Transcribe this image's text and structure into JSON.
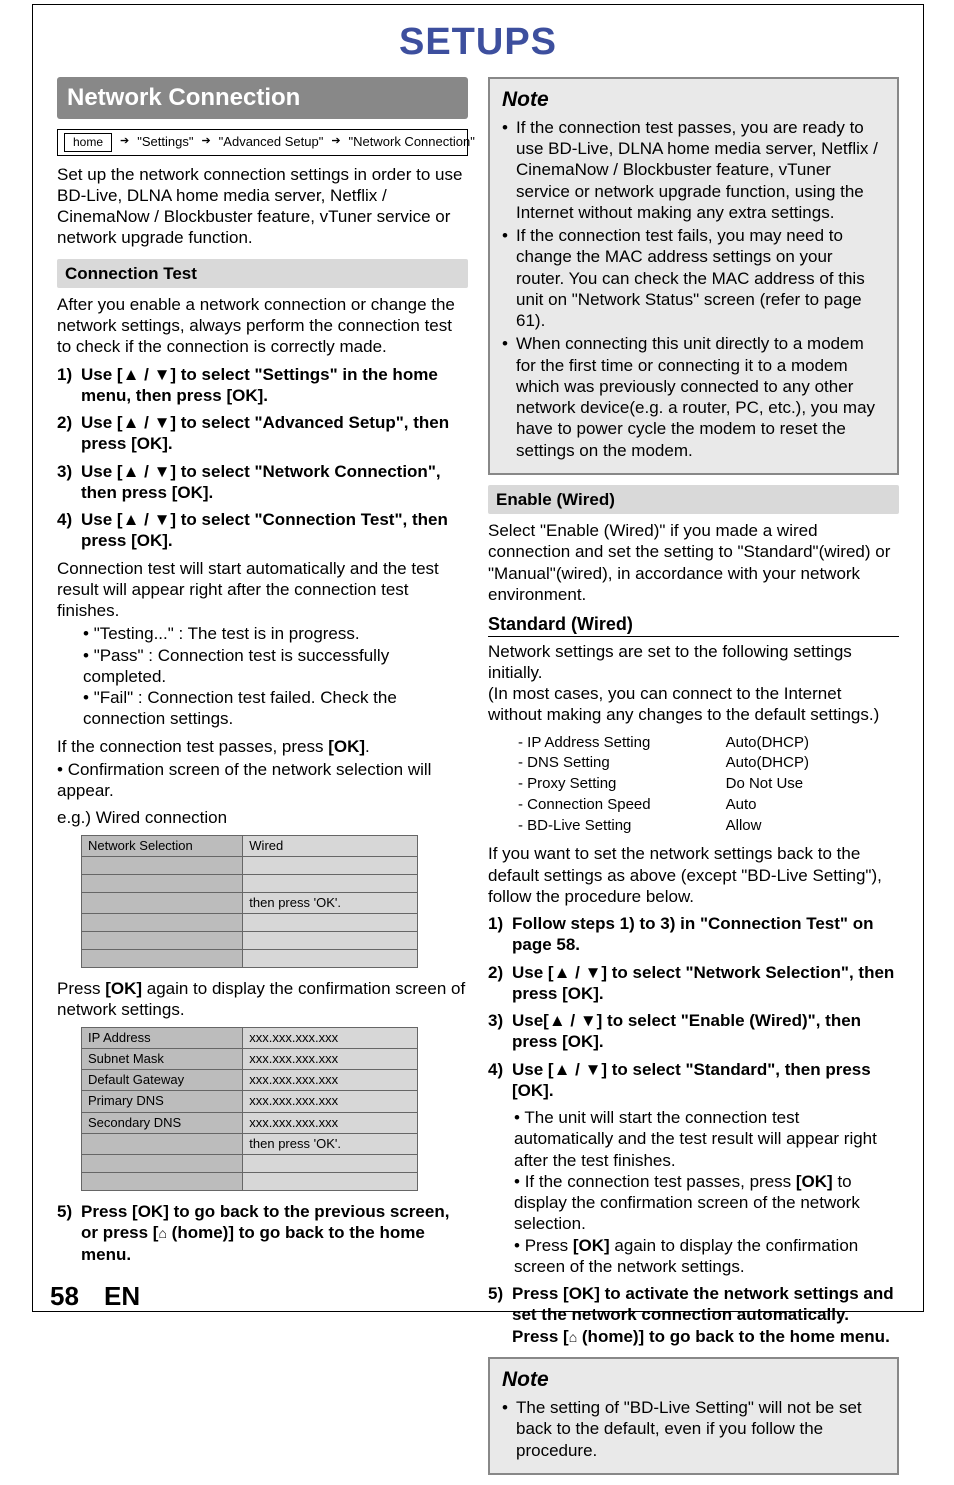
{
  "page_title": "SETUPS",
  "page_number": "58",
  "page_lang": "EN",
  "section_bar": "Network Connection",
  "breadcrumb": {
    "home": "home",
    "lvl1": "\"Settings\"",
    "lvl2": "\"Advanced Setup\"",
    "lvl3": "\"Network Connection\""
  },
  "intro": "Set up the network connection settings in order to use BD-Live, DLNA home media server, Netflix / CinemaNow / Blockbuster feature, vTuner service or network upgrade function.",
  "conn_test": {
    "heading": "Connection Test",
    "intro": "After you enable a network connection or change the network settings, always perform the connection test to check if the connection is correctly made.",
    "steps": [
      "Use [▲ / ▼] to select \"Settings\" in the home menu, then press [OK].",
      "Use [▲ / ▼] to select \"Advanced Setup\", then press [OK].",
      "Use [▲ / ▼] to select \"Network Connection\", then press [OK].",
      "Use [▲ / ▼] to select \"Connection Test\", then press [OK]."
    ],
    "after4": "Connection test will start automatically and the test result will appear right after the connection test finishes.",
    "results": [
      "\"Testing...\" : The test is in progress.",
      "\"Pass\" : Connection test is successfully completed.",
      "\"Fail\" : Connection test failed. Check the connection settings."
    ],
    "pass1_a": "If the connection test passes, press ",
    "pass1_b": "[OK]",
    "pass1_c": ".",
    "pass2": "Confirmation screen of the network selection will appear.",
    "eg": "e.g.) Wired connection",
    "table1": [
      [
        "Network Selection",
        "Wired"
      ],
      [
        "",
        ""
      ],
      [
        "",
        ""
      ],
      [
        "",
        "then press 'OK'."
      ],
      [
        "",
        ""
      ],
      [
        "",
        ""
      ],
      [
        "",
        ""
      ]
    ],
    "after_t1_a": "Press ",
    "after_t1_b": "[OK]",
    "after_t1_c": " again to display the confirmation screen of network settings.",
    "table2": [
      [
        "IP Address",
        "xxx.xxx.xxx.xxx"
      ],
      [
        "Subnet Mask",
        "xxx.xxx.xxx.xxx"
      ],
      [
        "Default Gateway",
        "xxx.xxx.xxx.xxx"
      ],
      [
        "Primary DNS",
        "xxx.xxx.xxx.xxx"
      ],
      [
        "Secondary DNS",
        "xxx.xxx.xxx.xxx"
      ],
      [
        "",
        "then press 'OK'."
      ],
      [
        "",
        ""
      ],
      [
        "",
        ""
      ]
    ],
    "step5_a": "Press [OK] to go back to the previous screen, or press [",
    "step5_b": " (home)] to go back to the home menu."
  },
  "note1": {
    "title": "Note",
    "items": [
      "If the connection test passes, you are ready to use BD-Live, DLNA home media server, Netflix / CinemaNow / Blockbuster feature, vTuner service or network upgrade function, using the Internet without making any extra settings.",
      "If the connection test fails, you may need to change the MAC address settings on your router. You can check the MAC address of this unit on \"Network Status\" screen (refer to page 61).",
      "When connecting this unit directly to a modem for the first time or connecting it to a modem which was previously connected to any other network device(e.g. a router, PC, etc.), you may have to power cycle the modem to reset the settings on the modem."
    ]
  },
  "enable": {
    "heading": "Enable (Wired)",
    "intro": "Select \"Enable (Wired)\" if you made a wired connection and set the setting to \"Standard\"(wired) or \"Manual\"(wired), in accordance with your network environment.",
    "sub": "Standard (Wired)",
    "sub_intro1": "Network settings are set to the following settings initially.",
    "sub_intro2": "(In most cases, you can connect to the Internet without making any changes to the default settings.)",
    "settings": [
      [
        "IP Address Setting",
        "Auto(DHCP)"
      ],
      [
        "DNS Setting",
        "Auto(DHCP)"
      ],
      [
        "Proxy Setting",
        "Do Not Use"
      ],
      [
        "Connection Speed",
        "Auto"
      ],
      [
        "BD-Live Setting",
        "Allow"
      ]
    ],
    "after_settings": "If you want to set the network settings back to the default settings as above (except \"BD-Live Setting\"), follow the procedure below.",
    "steps": [
      "Follow steps 1) to 3) in \"Connection Test\" on page 58.",
      "Use [▲ / ▼] to select \"Network Selection\", then press [OK].",
      "Use[▲ / ▼] to select \"Enable (Wired)\", then press [OK].",
      "Use [▲ / ▼] to select \"Standard\", then press [OK]."
    ],
    "step4_bullets_a": "The unit will start the connection test automatically and the test result will appear right after the test finishes.",
    "step4_bullets_b1": "If the connection test passes, press ",
    "step4_bullets_b2": "[OK]",
    "step4_bullets_b3": " to display the confirmation screen of the network selection.",
    "step4_bullets_c1": "Press ",
    "step4_bullets_c2": "[OK]",
    "step4_bullets_c3": " again to display the confirmation screen of the network settings.",
    "step5_l1": "Press [OK] to activate the network settings and set the network connection automatically.",
    "step5_l2a": "Press [",
    "step5_l2b": " (home)] to go back to the home menu."
  },
  "note2": {
    "title": "Note",
    "items": [
      "The setting of \"BD-Live Setting\" will not be set back to the default, even if you follow the procedure."
    ]
  }
}
